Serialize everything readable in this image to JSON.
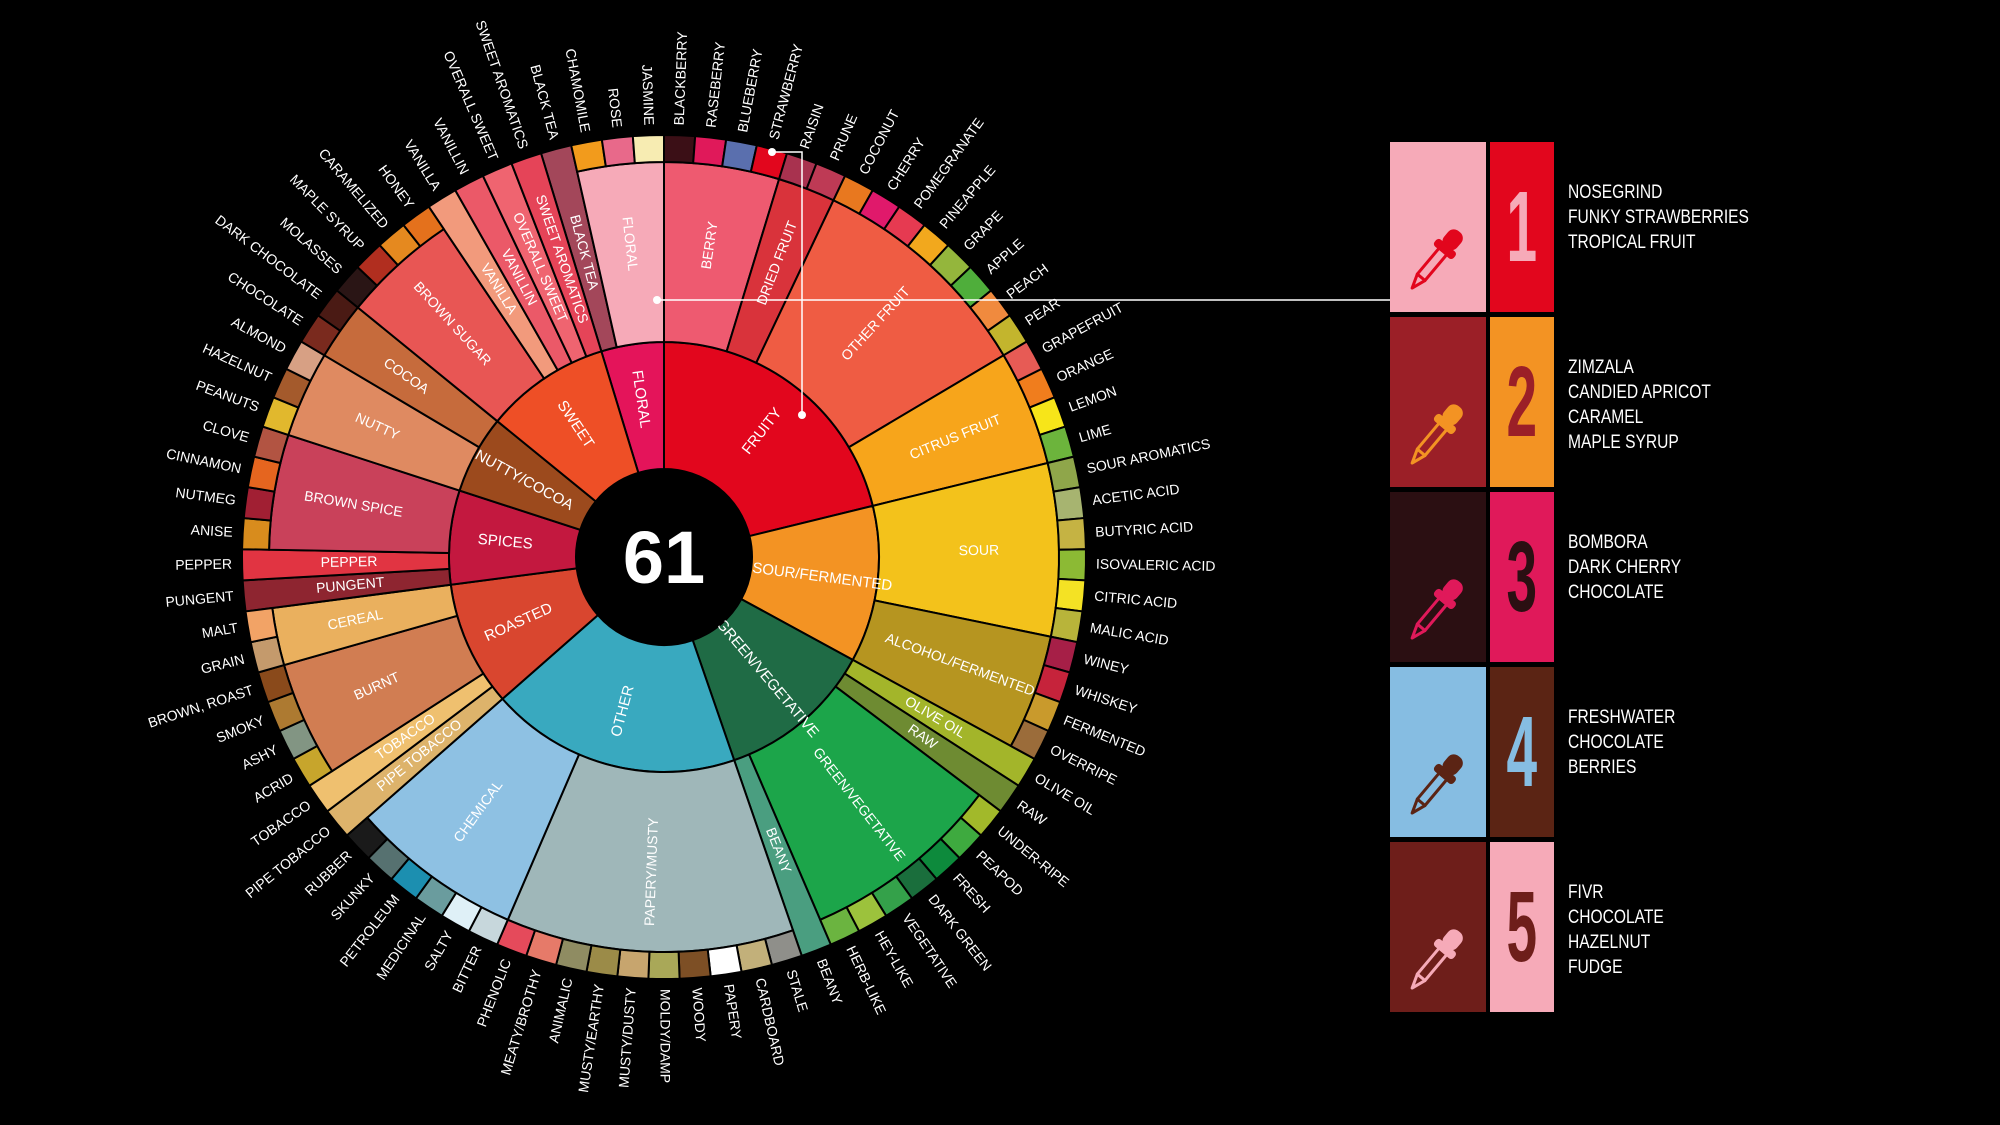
{
  "logo": "61",
  "colors": {
    "background": "#000000",
    "connector": "#ffffff"
  },
  "wheel": {
    "categories": [
      {
        "label": "FLORAL",
        "color": "#e4145a",
        "subs": [
          {
            "label": "BLACK TEA",
            "color": "#a3475a",
            "leaves": []
          },
          {
            "label": "FLORAL",
            "color": "#f6aab8",
            "leaves": [
              {
                "label": "CHAMOMILE",
                "color": "#f29b1c"
              },
              {
                "label": "ROSE",
                "color": "#e8698a"
              },
              {
                "label": "JASMINE",
                "color": "#f7ecb2"
              }
            ]
          }
        ]
      },
      {
        "label": "FRUITY",
        "color": "#e2061d",
        "subs": [
          {
            "label": "BERRY",
            "color": "#ee5a70",
            "leaves": [
              {
                "label": "BLACKBERRY",
                "color": "#3b0f16"
              },
              {
                "label": "RASEBERRY",
                "color": "#e0195a"
              },
              {
                "label": "BLUEBERRY",
                "color": "#5a6fae"
              },
              {
                "label": "STRAWBERRY",
                "color": "#e2061d"
              }
            ]
          },
          {
            "label": "DRIED FRUIT",
            "color": "#d9333b",
            "leaves": [
              {
                "label": "RAISIN",
                "color": "#a8324f"
              },
              {
                "label": "PRUNE",
                "color": "#be3a55"
              }
            ]
          },
          {
            "label": "OTHER FRUIT",
            "color": "#ef5c43",
            "leaves": [
              {
                "label": "COCONUT",
                "color": "#e8781f"
              },
              {
                "label": "CHERRY",
                "color": "#e0196b"
              },
              {
                "label": "POMEGRANATE",
                "color": "#e63a51"
              },
              {
                "label": "PINEAPPLE",
                "color": "#f2a81d"
              },
              {
                "label": "GRAPE",
                "color": "#94b63c"
              },
              {
                "label": "APPLE",
                "color": "#4fae3b"
              },
              {
                "label": "PEACH",
                "color": "#f08a3e"
              },
              {
                "label": "PEAR",
                "color": "#c3b52d"
              }
            ]
          },
          {
            "label": "CITRUS FRUIT",
            "color": "#f7a51b",
            "leaves": [
              {
                "label": "GRAPEFRUIT",
                "color": "#e75b55"
              },
              {
                "label": "ORANGE",
                "color": "#f07d1d"
              },
              {
                "label": "LEMON",
                "color": "#f7e519"
              },
              {
                "label": "LIME",
                "color": "#6cb43c"
              }
            ]
          }
        ]
      },
      {
        "label": "SOUR/FERMENTED",
        "color": "#f39323",
        "subs": [
          {
            "label": "SOUR",
            "color": "#f3c21b",
            "leaves": [
              {
                "label": "SOUR AROMATICS",
                "color": "#8fa64a"
              },
              {
                "label": "ACETIC ACID",
                "color": "#a7b470"
              },
              {
                "label": "BUTYRIC ACID",
                "color": "#c5b343"
              },
              {
                "label": "ISOVALERIC ACID",
                "color": "#8cba34"
              },
              {
                "label": "CITRIC ACID",
                "color": "#f4e224"
              },
              {
                "label": "MALIC ACID",
                "color": "#b8b43a"
              }
            ]
          },
          {
            "label": "ALCOHOL/FERMENTED",
            "color": "#b69520",
            "leaves": [
              {
                "label": "WINEY",
                "color": "#a61f47"
              },
              {
                "label": "WHISKEY",
                "color": "#c6233b"
              },
              {
                "label": "FERMENTED",
                "color": "#c99a2c"
              },
              {
                "label": "OVERRIPE",
                "color": "#9b6c3a"
              }
            ]
          }
        ]
      },
      {
        "label": "GREEN/VEGETATIVE",
        "color": "#1f6b45",
        "subs": [
          {
            "label": "OLIVE OIL",
            "color": "#a3b52a",
            "leaves": []
          },
          {
            "label": "RAW",
            "color": "#6e8b32",
            "leaves": []
          },
          {
            "label": "GREEN/VEGETATIVE",
            "color": "#1ca54a",
            "leaves": [
              {
                "label": "UNDER-RIPE",
                "color": "#a2b92a"
              },
              {
                "label": "PEAPOD",
                "color": "#3eaa3f"
              },
              {
                "label": "FRESH",
                "color": "#0d8a3c"
              },
              {
                "label": "DARK GREEN",
                "color": "#1a6e3c"
              },
              {
                "label": "VEGETATIVE",
                "color": "#34a14a"
              },
              {
                "label": "HEY-LIKE",
                "color": "#9cc23c"
              },
              {
                "label": "HERB-LIKE",
                "color": "#6bb440"
              }
            ]
          },
          {
            "label": "BEANY",
            "color": "#4a9e80",
            "leaves": []
          }
        ]
      },
      {
        "label": "OTHER",
        "color": "#39a9bf",
        "subs": [
          {
            "label": "PAPERY/MUSTY",
            "color": "#9fb7b9",
            "leaves": [
              {
                "label": "STALE",
                "color": "#8f8f8a"
              },
              {
                "label": "CARDBOARD",
                "color": "#c2b07a"
              },
              {
                "label": "PAPERY",
                "color": "#ffffff"
              },
              {
                "label": "WOODY",
                "color": "#7d4f25"
              },
              {
                "label": "MOLDY/DAMP",
                "color": "#a9a858"
              },
              {
                "label": "MUSTY/DUSTY",
                "color": "#c7a56e"
              },
              {
                "label": "MUSTY/EARTHY",
                "color": "#9b8b48"
              },
              {
                "label": "ANIMALIC",
                "color": "#8f8c62"
              },
              {
                "label": "MEATY/BROTHY",
                "color": "#e67a69"
              },
              {
                "label": "PHENOLIC",
                "color": "#e54a5b"
              }
            ]
          },
          {
            "label": "CHEMICAL",
            "color": "#8ec1e3",
            "leaves": [
              {
                "label": "BITTER",
                "color": "#c7d7dc"
              },
              {
                "label": "SALTY",
                "color": "#dff0f7"
              },
              {
                "label": "MEDICINAL",
                "color": "#6a9c9e"
              },
              {
                "label": "PETROLEUM",
                "color": "#1c8fb0"
              },
              {
                "label": "SKUNKY",
                "color": "#567170"
              },
              {
                "label": "RUBBER",
                "color": "#1a1a1a"
              }
            ]
          }
        ]
      },
      {
        "label": "ROASTED",
        "color": "#d9462f",
        "subs": [
          {
            "label": "PIPE TOBACCO",
            "color": "#ddb36b",
            "leaves": []
          },
          {
            "label": "TOBACCO",
            "color": "#efc06f",
            "leaves": []
          },
          {
            "label": "BURNT",
            "color": "#d17d52",
            "leaves": [
              {
                "label": "ACRID",
                "color": "#c7a52c"
              },
              {
                "label": "ASHY",
                "color": "#829583"
              },
              {
                "label": "SMOKY",
                "color": "#ad7a31"
              },
              {
                "label": "BROWN, ROAST",
                "color": "#8a4a1b"
              }
            ]
          },
          {
            "label": "CEREAL",
            "color": "#eab05e",
            "leaves": [
              {
                "label": "GRAIN",
                "color": "#c49a6c"
              },
              {
                "label": "MALT",
                "color": "#f2a366"
              }
            ]
          }
        ]
      },
      {
        "label": "SPICES",
        "color": "#c3183f",
        "subs": [
          {
            "label": "PUNGENT",
            "color": "#8e2530",
            "leaves": []
          },
          {
            "label": "PEPPER",
            "color": "#e13442",
            "leaves": []
          },
          {
            "label": "BROWN SPICE",
            "color": "#c9415a",
            "leaves": [
              {
                "label": "ANISE",
                "color": "#d88c1d"
              },
              {
                "label": "NUTMEG",
                "color": "#a11f33"
              },
              {
                "label": "CINNAMON",
                "color": "#e5651f"
              },
              {
                "label": "CLOVE",
                "color": "#b25442"
              }
            ]
          }
        ]
      },
      {
        "label": "NUTTY/COCOA",
        "color": "#9c4a1d",
        "subs": [
          {
            "label": "NUTTY",
            "color": "#df8a61",
            "leaves": [
              {
                "label": "PEANUTS",
                "color": "#e1b82d"
              },
              {
                "label": "HAZELNUT",
                "color": "#a45a2c"
              },
              {
                "label": "ALMOND",
                "color": "#d7a084"
              }
            ]
          },
          {
            "label": "COCOA",
            "color": "#c66b3c",
            "leaves": [
              {
                "label": "CHOCOLATE",
                "color": "#7a2a1e"
              },
              {
                "label": "DARK CHOCOLATE",
                "color": "#4a1a14"
              }
            ]
          }
        ]
      },
      {
        "label": "SWEET",
        "color": "#ee4f26",
        "subs": [
          {
            "label": "BROWN SUGAR",
            "color": "#e85654",
            "leaves": [
              {
                "label": "MOLASSES",
                "color": "#2a1515"
              },
              {
                "label": "MAPLE SYRUP",
                "color": "#b12e1f"
              },
              {
                "label": "CARAMELIZED",
                "color": "#e5891f"
              },
              {
                "label": "HONEY",
                "color": "#e4711c"
              }
            ]
          },
          {
            "label": "VANILLA",
            "color": "#f29a7c",
            "leaves": []
          },
          {
            "label": "VANILLIN",
            "color": "#eb5968",
            "leaves": []
          },
          {
            "label": "OVERALL SWEET",
            "color": "#ef6470",
            "leaves": []
          },
          {
            "label": "SWEET AROMATICS",
            "color": "#e54458",
            "leaves": []
          }
        ]
      }
    ]
  },
  "samples": [
    {
      "number": "1",
      "lines": [
        "NOSEGRIND",
        "FUNKY STRAWBERRIES",
        "TROPICAL FRUIT"
      ],
      "dropper_bg": "#f6aab8",
      "number_bg": "#e2061d",
      "number_color": "#f6aab8",
      "dropper_color": "#e2061d",
      "dropper_icon": "pipette-icon"
    },
    {
      "number": "2",
      "lines": [
        "ZIMZALA",
        "CANDIED APRICOT",
        "CARAMEL",
        "MAPLE SYRUP"
      ],
      "dropper_bg": "#9b1f27",
      "number_bg": "#f39323",
      "number_color": "#9b1f27",
      "dropper_color": "#f39323",
      "dropper_icon": "pipette-icon"
    },
    {
      "number": "3",
      "lines": [
        "BOMBORA",
        "DARK CHERRY",
        "CHOCOLATE"
      ],
      "dropper_bg": "#2b0f12",
      "number_bg": "#e0195a",
      "number_color": "#2b0f12",
      "dropper_color": "#e0195a",
      "dropper_icon": "pipette-icon"
    },
    {
      "number": "4",
      "lines": [
        "FRESHWATER",
        "CHOCOLATE",
        "BERRIES"
      ],
      "dropper_bg": "#86bde2",
      "number_bg": "#5b2414",
      "number_color": "#86bde2",
      "dropper_color": "#5b2414",
      "dropper_icon": "pipette-icon"
    },
    {
      "number": "5",
      "lines": [
        "FIVR",
        "CHOCOLATE",
        "HAZELNUT",
        "FUDGE"
      ],
      "dropper_bg": "#6e1e1a",
      "number_bg": "#f6aab8",
      "number_color": "#6e1e1a",
      "dropper_color": "#f6aab8",
      "dropper_icon": "pipette-icon"
    }
  ]
}
